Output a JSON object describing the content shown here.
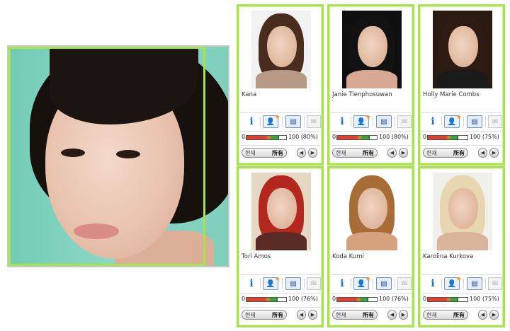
{
  "main_photo": {
    "icon": "portrait-photo"
  },
  "cards": [
    {
      "name": "Kana",
      "score_min": "0",
      "score_max": "100 (80%)",
      "score_value": 0.8,
      "toggle": [
        "현재",
        "所有"
      ],
      "colors": {
        "bg": "#f2f2f2",
        "hair": "#4a2c1f",
        "shoulder": "#b69a86"
      }
    },
    {
      "name": "Janie Tienphosuwan",
      "score_min": "0",
      "score_max": "100 (80%)",
      "score_value": 0.8,
      "toggle": [
        "현재",
        "所有"
      ],
      "colors": {
        "bg": "#0f0f12",
        "hair": "#121212",
        "shoulder": "#d9a894"
      }
    },
    {
      "name": "Holly Marie Combs",
      "score_min": "0",
      "score_max": "100 (75%)",
      "score_value": 0.75,
      "toggle": [
        "현재",
        "所有"
      ],
      "colors": {
        "bg": "#2a1a12",
        "hair": "#2d1b12",
        "shoulder": "#1a1a1a"
      }
    },
    {
      "name": "Tori Amos",
      "score_min": "0",
      "score_max": "100 (76%)",
      "score_value": 0.76,
      "toggle": [
        "현재",
        "所有"
      ],
      "colors": {
        "bg": "#e7d8c4",
        "hair": "#b4271e",
        "shoulder": "#5a2a24"
      }
    },
    {
      "name": "Koda Kumi",
      "score_min": "0",
      "score_max": "100 (76%)",
      "score_value": 0.76,
      "toggle": [
        "현재",
        "所有"
      ],
      "colors": {
        "bg": "#ffffff",
        "hair": "#a86c36",
        "shoulder": "#d6a27e"
      }
    },
    {
      "name": "Karolina Kurkova",
      "score_min": "0",
      "score_max": "100 (75%)",
      "score_value": 0.75,
      "toggle": [
        "현재",
        "所有"
      ],
      "colors": {
        "bg": "#f1efec",
        "hair": "#e7d6b0",
        "shoulder": "#d9b49a"
      }
    }
  ],
  "icons": {
    "info": "info-icon",
    "person": "person-star-icon",
    "card": "contact-card-icon",
    "mail": "envelope-icon",
    "prev": "arrow-left-icon",
    "next": "arrow-right-icon"
  },
  "accent": "#a9e34b"
}
